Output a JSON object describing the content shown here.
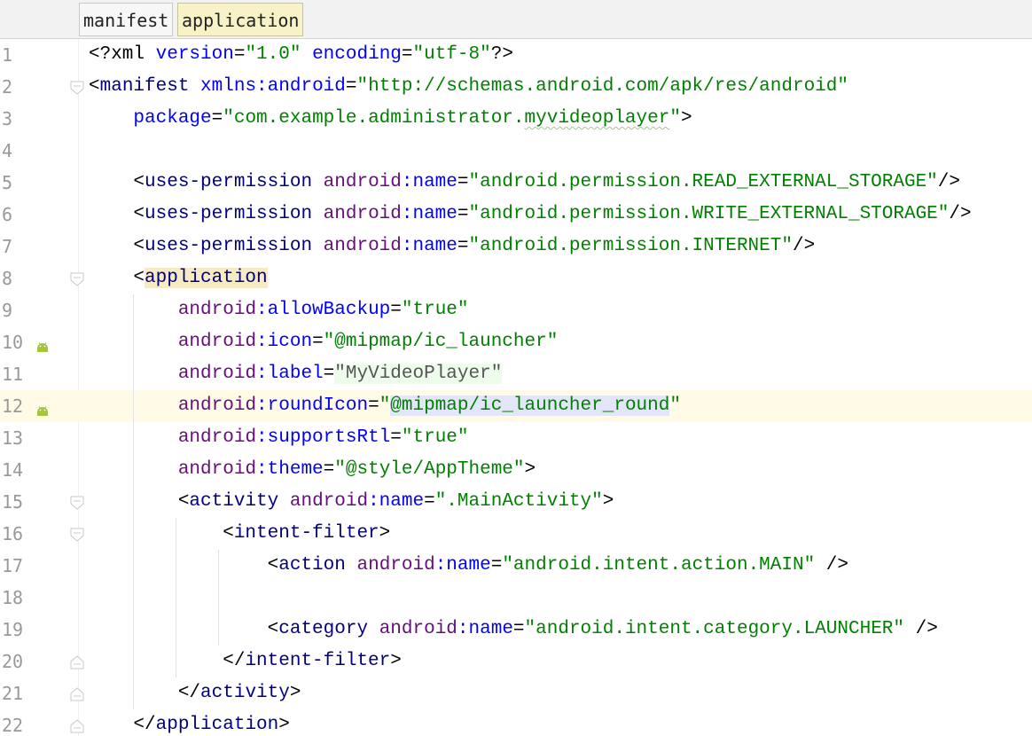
{
  "breadcrumbs": [
    "manifest",
    "application"
  ],
  "lines": [
    {
      "n": "1",
      "parts": [
        [
          "pi",
          "<?xml "
        ],
        [
          "attr",
          "version"
        ],
        [
          "br",
          "="
        ],
        [
          "val",
          "\"1.0\""
        ],
        [
          "br",
          " "
        ],
        [
          "attr",
          "encoding"
        ],
        [
          "br",
          "="
        ],
        [
          "val",
          "\"utf-8\""
        ],
        [
          "pi",
          "?>"
        ]
      ]
    },
    {
      "n": "2",
      "parts": [
        [
          "br",
          "<"
        ],
        [
          "tag",
          "manifest"
        ],
        [
          "br",
          " "
        ],
        [
          "attr",
          "xmlns:android"
        ],
        [
          "br",
          "="
        ],
        [
          "val",
          "\"http://schemas.android.com/apk/res/android\""
        ]
      ]
    },
    {
      "n": "3",
      "parts": [
        [
          "br",
          "    "
        ],
        [
          "attr",
          "package"
        ],
        [
          "br",
          "="
        ],
        [
          "val",
          "\"com.example.administrator."
        ],
        [
          "valsq",
          "myvideoplayer"
        ],
        [
          "val",
          "\""
        ],
        [
          "br",
          ">"
        ]
      ]
    },
    {
      "n": "4",
      "parts": []
    },
    {
      "n": "5",
      "parts": [
        [
          "br",
          "    <"
        ],
        [
          "tag",
          "uses-permission"
        ],
        [
          "br",
          " "
        ],
        [
          "ns",
          "android"
        ],
        [
          "attr",
          ":name"
        ],
        [
          "br",
          "="
        ],
        [
          "val",
          "\"android.permission.READ_EXTERNAL_STORAGE\""
        ],
        [
          "br",
          "/>"
        ]
      ]
    },
    {
      "n": "6",
      "parts": [
        [
          "br",
          "    <"
        ],
        [
          "tag",
          "uses-permission"
        ],
        [
          "br",
          " "
        ],
        [
          "ns",
          "android"
        ],
        [
          "attr",
          ":name"
        ],
        [
          "br",
          "="
        ],
        [
          "val",
          "\"android.permission.WRITE_EXTERNAL_STORAGE\""
        ],
        [
          "br",
          "/>"
        ]
      ]
    },
    {
      "n": "7",
      "parts": [
        [
          "br",
          "    <"
        ],
        [
          "tag",
          "uses-permission"
        ],
        [
          "br",
          " "
        ],
        [
          "ns",
          "android"
        ],
        [
          "attr",
          ":name"
        ],
        [
          "br",
          "="
        ],
        [
          "val",
          "\"android.permission.INTERNET\""
        ],
        [
          "br",
          "/>"
        ]
      ]
    },
    {
      "n": "8",
      "parts": [
        [
          "br",
          "    <"
        ],
        [
          "taghl",
          "application"
        ]
      ]
    },
    {
      "n": "9",
      "parts": [
        [
          "br",
          "        "
        ],
        [
          "ns",
          "android"
        ],
        [
          "attr",
          ":allowBackup"
        ],
        [
          "br",
          "="
        ],
        [
          "val",
          "\"true\""
        ]
      ]
    },
    {
      "n": "10",
      "parts": [
        [
          "br",
          "        "
        ],
        [
          "ns",
          "android"
        ],
        [
          "attr",
          ":icon"
        ],
        [
          "br",
          "="
        ],
        [
          "val",
          "\"@mipmap/ic_launcher\""
        ]
      ]
    },
    {
      "n": "11",
      "parts": [
        [
          "br",
          "        "
        ],
        [
          "ns",
          "android"
        ],
        [
          "attr",
          ":label"
        ],
        [
          "br",
          "="
        ],
        [
          "labelhl",
          "\"MyVideoPlayer\""
        ]
      ]
    },
    {
      "n": "12",
      "parts": [
        [
          "br",
          "        "
        ],
        [
          "ns",
          "android"
        ],
        [
          "attr",
          ":roundIcon"
        ],
        [
          "br",
          "="
        ],
        [
          "val",
          "\""
        ],
        [
          "roundhl",
          "@mipmap/ic_launcher_round"
        ],
        [
          "val",
          "\""
        ]
      ]
    },
    {
      "n": "13",
      "parts": [
        [
          "br",
          "        "
        ],
        [
          "ns",
          "android"
        ],
        [
          "attr",
          ":supportsRtl"
        ],
        [
          "br",
          "="
        ],
        [
          "val",
          "\"true\""
        ]
      ]
    },
    {
      "n": "14",
      "parts": [
        [
          "br",
          "        "
        ],
        [
          "ns",
          "android"
        ],
        [
          "attr",
          ":theme"
        ],
        [
          "br",
          "="
        ],
        [
          "val",
          "\"@style/AppTheme\""
        ],
        [
          "br",
          ">"
        ]
      ]
    },
    {
      "n": "15",
      "parts": [
        [
          "br",
          "        <"
        ],
        [
          "tag",
          "activity"
        ],
        [
          "br",
          " "
        ],
        [
          "ns",
          "android"
        ],
        [
          "attr",
          ":name"
        ],
        [
          "br",
          "="
        ],
        [
          "val",
          "\".MainActivity\""
        ],
        [
          "br",
          ">"
        ]
      ]
    },
    {
      "n": "16",
      "parts": [
        [
          "br",
          "            <"
        ],
        [
          "tag",
          "intent-filter"
        ],
        [
          "br",
          ">"
        ]
      ]
    },
    {
      "n": "17",
      "parts": [
        [
          "br",
          "                <"
        ],
        [
          "tag",
          "action"
        ],
        [
          "br",
          " "
        ],
        [
          "ns",
          "android"
        ],
        [
          "attr",
          ":name"
        ],
        [
          "br",
          "="
        ],
        [
          "val",
          "\"android.intent.action.MAIN\""
        ],
        [
          "br",
          " />"
        ]
      ]
    },
    {
      "n": "18",
      "parts": []
    },
    {
      "n": "19",
      "parts": [
        [
          "br",
          "                <"
        ],
        [
          "tag",
          "category"
        ],
        [
          "br",
          " "
        ],
        [
          "ns",
          "android"
        ],
        [
          "attr",
          ":name"
        ],
        [
          "br",
          "="
        ],
        [
          "val",
          "\"android.intent.category.LAUNCHER\""
        ],
        [
          "br",
          " />"
        ]
      ]
    },
    {
      "n": "20",
      "parts": [
        [
          "br",
          "            </"
        ],
        [
          "tag",
          "intent-filter"
        ],
        [
          "br",
          ">"
        ]
      ]
    },
    {
      "n": "21",
      "parts": [
        [
          "br",
          "        </"
        ],
        [
          "tag",
          "activity"
        ],
        [
          "br",
          ">"
        ]
      ]
    },
    {
      "n": "22",
      "parts": [
        [
          "br",
          "    </"
        ],
        [
          "tag",
          "application"
        ],
        [
          "br",
          ">"
        ]
      ]
    }
  ],
  "current_line": "12",
  "android_icon_lines": [
    "10",
    "12"
  ],
  "fold_open_lines": [
    "2",
    "8",
    "15",
    "16"
  ],
  "fold_close_lines": [
    "20",
    "21",
    "22"
  ],
  "colors": {
    "tag": "#000080",
    "attribute": "#0000ff",
    "namespace": "#660e7a",
    "value": "#008000",
    "current_line_bg": "#fffbe6",
    "android_icon": "#a4c639"
  }
}
